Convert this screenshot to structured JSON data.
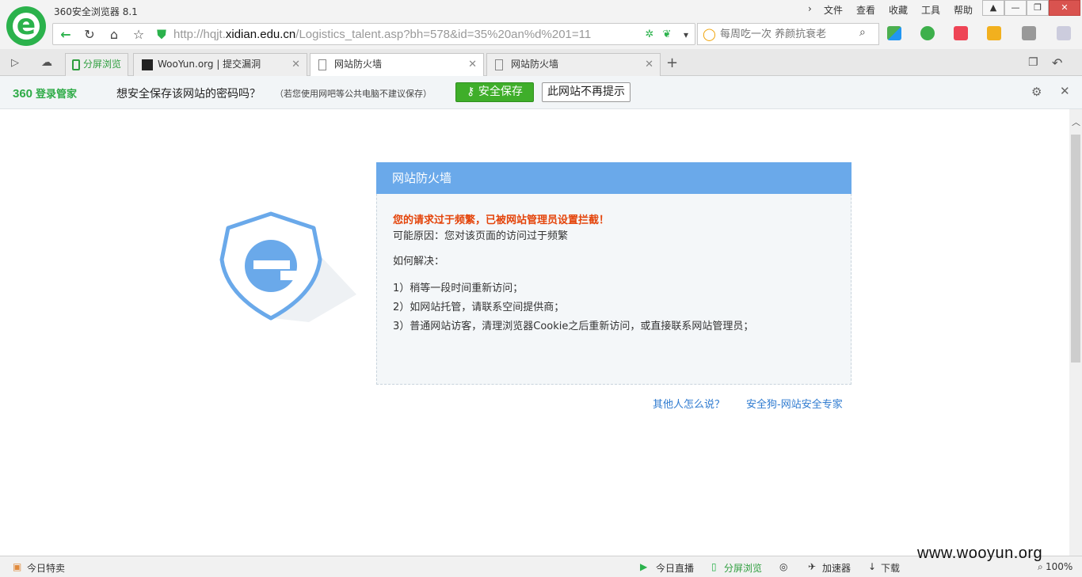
{
  "app": {
    "title": "360安全浏览器 8.1",
    "logo_letter": "e"
  },
  "menu": {
    "file": "文件",
    "view": "查看",
    "favorites": "收藏",
    "tools": "工具",
    "help": "帮助"
  },
  "address": {
    "url_prefix": "http://hqjt.",
    "url_domain": "xidian.edu.cn",
    "url_path": "/Logistics_talent.asp?bh=578&id=35%20an%d%201=11"
  },
  "search": {
    "placeholder": "每周吃一次 养颜抗衰老"
  },
  "tabs": [
    {
      "label": "分屏浏览",
      "active": false
    },
    {
      "label": "WooYun.org | 提交漏洞",
      "active": false
    },
    {
      "label": "网站防火墙",
      "active": true
    },
    {
      "label": "网站防火墙",
      "active": false
    }
  ],
  "notify": {
    "brand": "360",
    "brand_sub": "登录管家",
    "message": "想安全保存该网站的密码吗？",
    "hint": "（若您使用网吧等公共电脑不建议保存）",
    "save_label": "安全保存",
    "nomore_label": "此网站不再提示"
  },
  "firewall": {
    "title": "网站防火墙",
    "warning": "您的请求过于频繁，已被网站管理员设置拦截！",
    "reason": "可能原因：您对该页面的访问过于频繁",
    "how_title": "如何解决：",
    "steps": [
      "1）稍等一段时间重新访问；",
      "2）如网站托管，请联系空间提供商；",
      "3）普通网站访客，清理浏览器Cookie之后重新访问，或直接联系网站管理员；"
    ],
    "link_others": "其他人怎么说？",
    "link_expert": "安全狗-网站安全专家"
  },
  "status": {
    "today_sale": "今日特卖",
    "live": "今日直播",
    "split": "分屏浏览",
    "accelerator": "加速器",
    "download": "下载",
    "zoom": "100%"
  },
  "watermark": "www.wooyun.org",
  "colors": {
    "brand_green": "#2bb24c",
    "header_blue": "#6aa9ea",
    "warning_red": "#e4440a",
    "link_blue": "#2f7bd0"
  }
}
